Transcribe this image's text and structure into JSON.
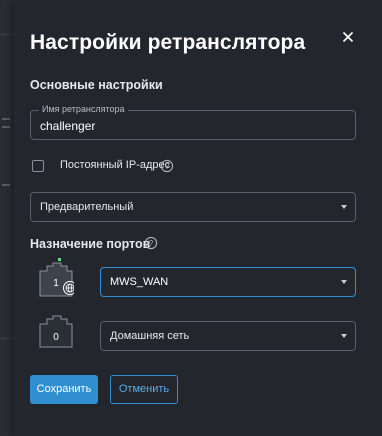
{
  "dialog": {
    "title": "Настройки ретранслятора",
    "close_icon": "close-icon"
  },
  "basic": {
    "section_title": "Основные настройки",
    "name_field": {
      "label": "Имя ретранслятора",
      "value": "challenger"
    },
    "static_ip": {
      "label": "Постоянный IP-адрес",
      "checked": false
    },
    "mode_select": {
      "value": "Предварительный"
    }
  },
  "ports": {
    "section_title": "Назначение портов",
    "items": [
      {
        "port_number": "1",
        "network": "MWS_WAN",
        "status": "connected",
        "icon": "globe-icon"
      },
      {
        "port_number": "0",
        "network": "Домашняя сеть",
        "status": "idle"
      }
    ]
  },
  "actions": {
    "save": "Сохранить",
    "cancel": "Отменить"
  },
  "colors": {
    "accent": "#2f8fd1",
    "link_active": "#6fdc6f",
    "dialog_bg": "#23272d"
  }
}
